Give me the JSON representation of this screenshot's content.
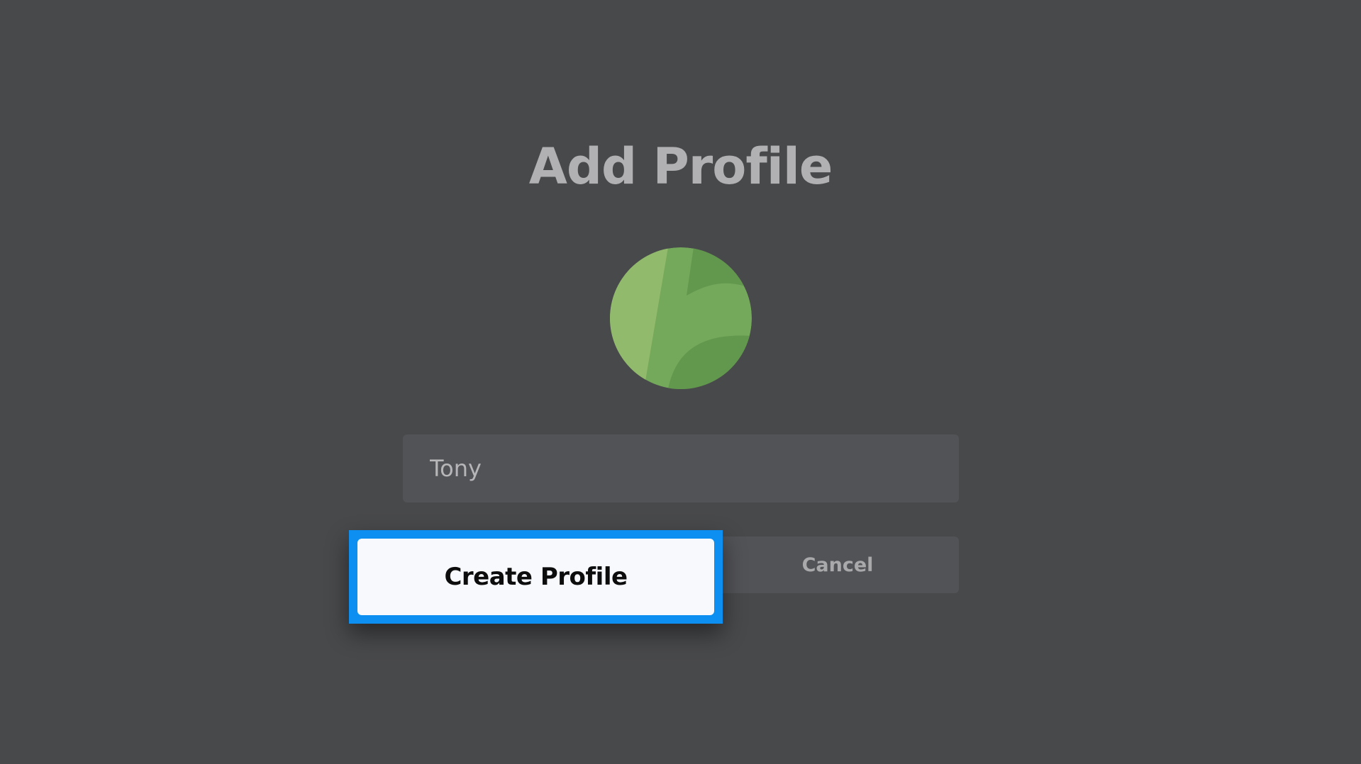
{
  "page": {
    "title": "Add Profile"
  },
  "avatar": {
    "icon": "green-abstract-avatar-icon",
    "colors": {
      "base": "#74a85a",
      "light": "#92ba6d",
      "dark": "#62974e"
    }
  },
  "profile_form": {
    "name_value": "Tony",
    "name_placeholder": ""
  },
  "actions": {
    "create_label": "Create Profile",
    "cancel_label": "Cancel"
  },
  "theme": {
    "background": "#48494b",
    "focus_color": "#0c8ff0"
  }
}
